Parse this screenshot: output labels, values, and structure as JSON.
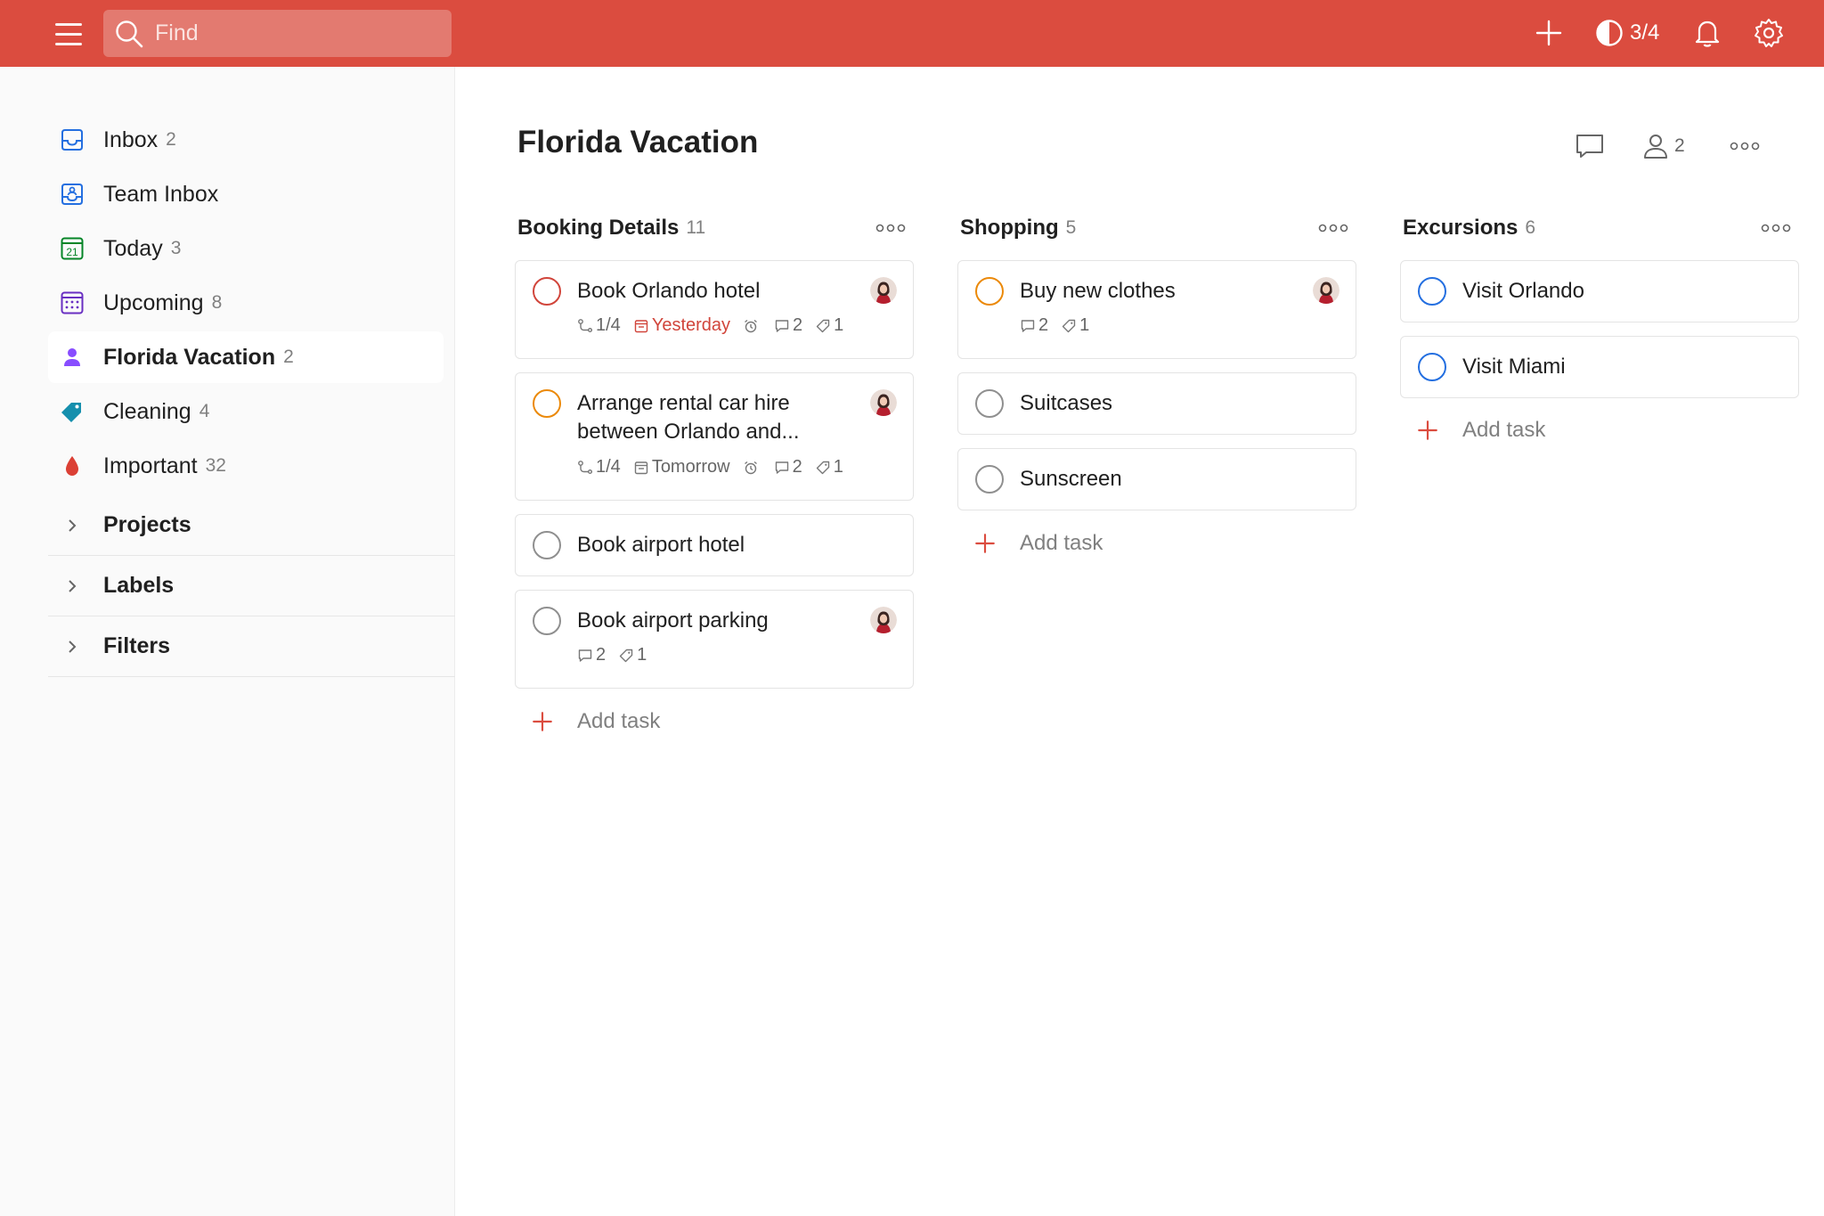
{
  "colors": {
    "brand": "#db4c3f",
    "priority1": "#d1453b",
    "priority2": "#eb8909",
    "priority3": "#246fe0",
    "neutral": "#8f8f8f"
  },
  "topbar": {
    "search_placeholder": "Find",
    "karma": "3/4",
    "icons": [
      "menu-icon",
      "search-icon",
      "plus-icon",
      "karma-icon",
      "bell-icon",
      "gear-icon"
    ]
  },
  "sidebar": {
    "items": [
      {
        "label": "Inbox",
        "count": "2",
        "icon": "inbox-icon"
      },
      {
        "label": "Team Inbox",
        "count": "",
        "icon": "team-inbox-icon"
      },
      {
        "label": "Today",
        "count": "3",
        "icon": "calendar-today-icon",
        "icon_text": "21"
      },
      {
        "label": "Upcoming",
        "count": "8",
        "icon": "calendar-upcoming-icon"
      },
      {
        "label": "Florida Vacation",
        "count": "2",
        "icon": "person-icon",
        "active": true
      },
      {
        "label": "Cleaning",
        "count": "4",
        "icon": "tag-icon"
      },
      {
        "label": "Important",
        "count": "32",
        "icon": "drop-icon"
      }
    ],
    "sections": [
      {
        "label": "Projects"
      },
      {
        "label": "Labels"
      },
      {
        "label": "Filters"
      }
    ]
  },
  "project": {
    "title": "Florida Vacation",
    "collaborators": "2"
  },
  "add_task_label": "Add task",
  "columns": [
    {
      "title": "Booking Details",
      "count": "11",
      "tasks": [
        {
          "title": "Book Orlando hotel",
          "priority": "red",
          "subtasks": "1/4",
          "due": "Yesterday",
          "comments": "2",
          "labels": "1",
          "avatar": true
        },
        {
          "title": "Arrange rental car hire between Orlando and...",
          "priority": "orange",
          "subtasks": "1/4",
          "due": "Tomorrow",
          "comments": "2",
          "labels": "1",
          "avatar": true
        },
        {
          "title": "Book airport hotel",
          "priority": "none"
        },
        {
          "title": "Book airport parking",
          "priority": "none",
          "comments": "2",
          "labels": "1",
          "avatar": true
        }
      ]
    },
    {
      "title": "Shopping",
      "count": "5",
      "tasks": [
        {
          "title": "Buy new clothes",
          "priority": "orange",
          "comments": "2",
          "labels": "1",
          "avatar": true
        },
        {
          "title": "Suitcases",
          "priority": "none"
        },
        {
          "title": "Sunscreen",
          "priority": "none"
        }
      ]
    },
    {
      "title": "Excursions",
      "count": "6",
      "tasks": [
        {
          "title": "Visit Orlando",
          "priority": "blue"
        },
        {
          "title": "Visit Miami",
          "priority": "blue"
        }
      ]
    }
  ]
}
